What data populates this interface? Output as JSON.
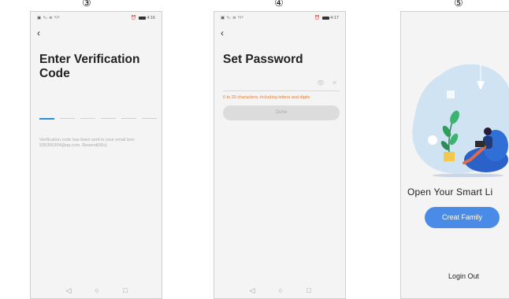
{
  "steps": {
    "step3": "③",
    "step4": "④",
    "step5": "⑤"
  },
  "phone3": {
    "status_left": "▣ ᵃᵢₗ ≋ ᵏ/ˢ",
    "status_right": "4:16",
    "back_icon": "arrow-left-icon",
    "title_line1": "Enter Verification",
    "title_line2": "Code",
    "hint_line1": "Verification code has been sent to your email box:",
    "hint_line2": "535356304@qq.com. Resend(56s)",
    "nav": {
      "back": "◁",
      "home": "○",
      "recent": "□"
    }
  },
  "phone4": {
    "status_left": "▣ ᵃᵢₗ ≋ ᵏ/ˢ",
    "status_right": "4:17",
    "back_icon": "arrow-left-icon",
    "title": "Set Password",
    "eye_icon": "👁",
    "clear_icon": "✕",
    "password_hint": "6 to 20 characters, including letters and digits",
    "done_label": "Done",
    "nav": {
      "back": "◁",
      "home": "○",
      "recent": "□"
    }
  },
  "phone5": {
    "welcome_title": "Open Your Smart Li",
    "create_label": "Creat Family",
    "login_out_label": "Login Out"
  },
  "colors": {
    "accent_blue": "#4a8be8",
    "active_slot": "#2f8ed8",
    "warning_orange": "#e07a3a",
    "blob_blue": "#cfe3f2",
    "bean_bag_blue": "#2b62c9"
  }
}
